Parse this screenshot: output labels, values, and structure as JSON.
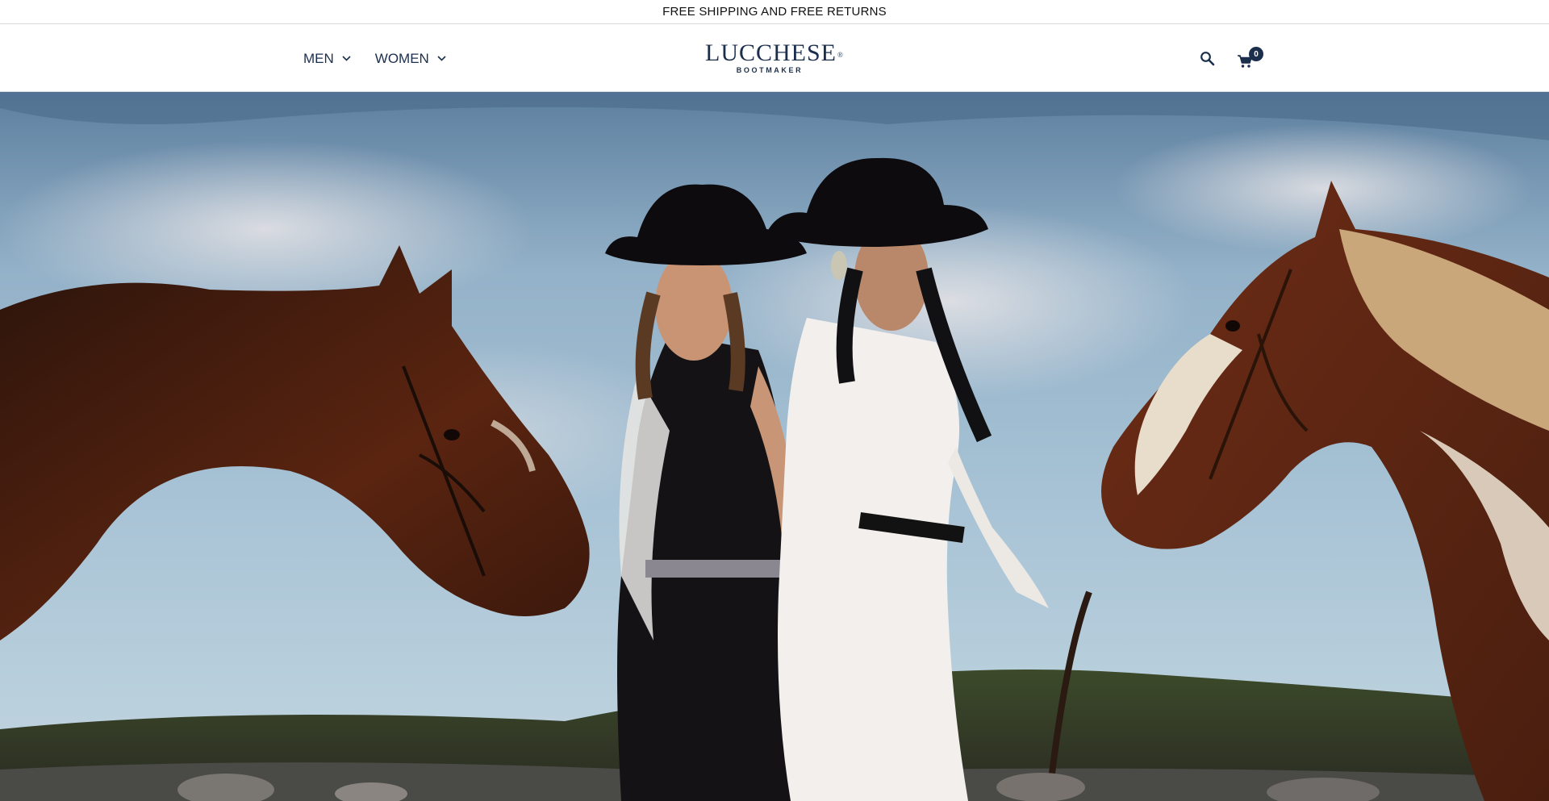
{
  "announcement": {
    "text": "FREE SHIPPING AND FREE RETURNS"
  },
  "nav": {
    "items": [
      {
        "label": "MEN",
        "icon": "chevron-down-icon"
      },
      {
        "label": "WOMEN",
        "icon": "chevron-down-icon"
      }
    ]
  },
  "logo": {
    "name": "LUCCHESE",
    "registered": "®",
    "tagline": "BOOTMAKER"
  },
  "header_icons": {
    "search": "search-icon",
    "cart": "cart-icon",
    "cart_count": "0"
  },
  "hero": {
    "alt": "Two women in black cowboy hats standing back to back between two horses under a cloudy sky"
  },
  "colors": {
    "brand_navy": "#1b2f4d",
    "announcement_bg": "#ffffff",
    "header_bg": "#ffffff"
  }
}
